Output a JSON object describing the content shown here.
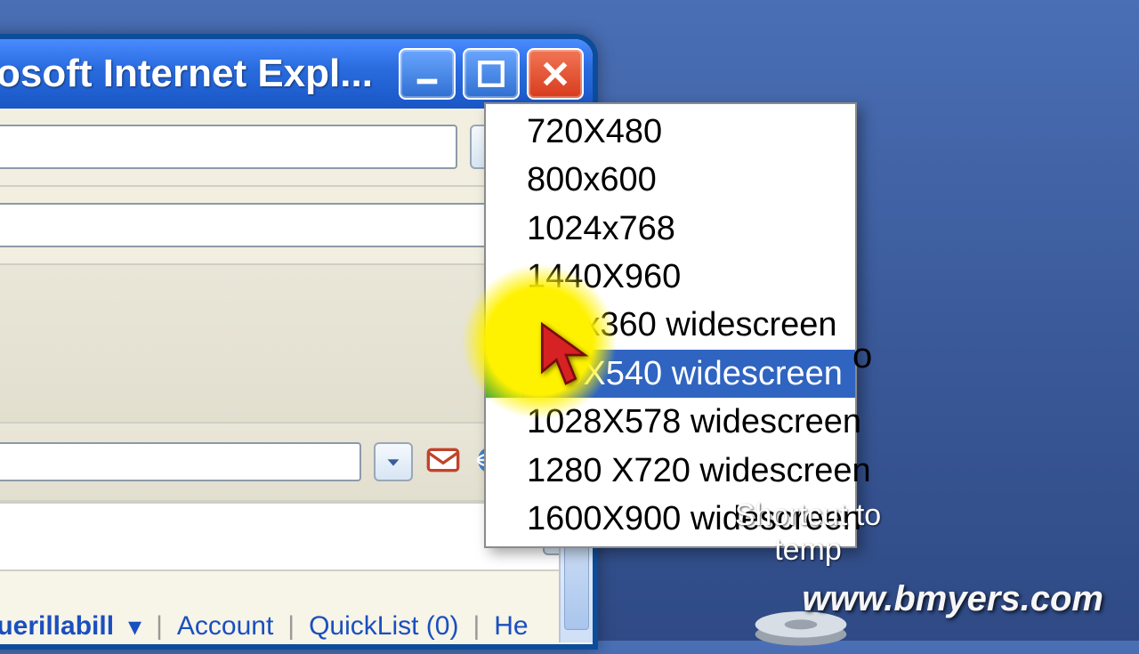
{
  "window": {
    "title": "osoft Internet Expl..."
  },
  "menu": {
    "items": [
      {
        "label": "720X480",
        "selected": false
      },
      {
        "label": "800x600",
        "selected": false
      },
      {
        "label": "1024x768",
        "selected": false
      },
      {
        "label": "1440X960",
        "selected": false
      },
      {
        "label": "640x360 widescreen",
        "selected": false
      },
      {
        "label": "960X540 widescreen",
        "selected": true
      },
      {
        "label": "1028X578 widescreen",
        "selected": false
      },
      {
        "label": "1280 X720 widescreen",
        "selected": false
      },
      {
        "label": "1600X900 widescreen",
        "selected": false
      }
    ]
  },
  "bottom": {
    "username": "guerillabill",
    "account": "Account",
    "quicklist": "QuickList (0)",
    "help": "He"
  },
  "desktop": {
    "shortcut_label_1": "Shortcut to",
    "shortcut_label_2": "temp"
  },
  "watermark": "www.bmyers.com",
  "peek_char": "o"
}
